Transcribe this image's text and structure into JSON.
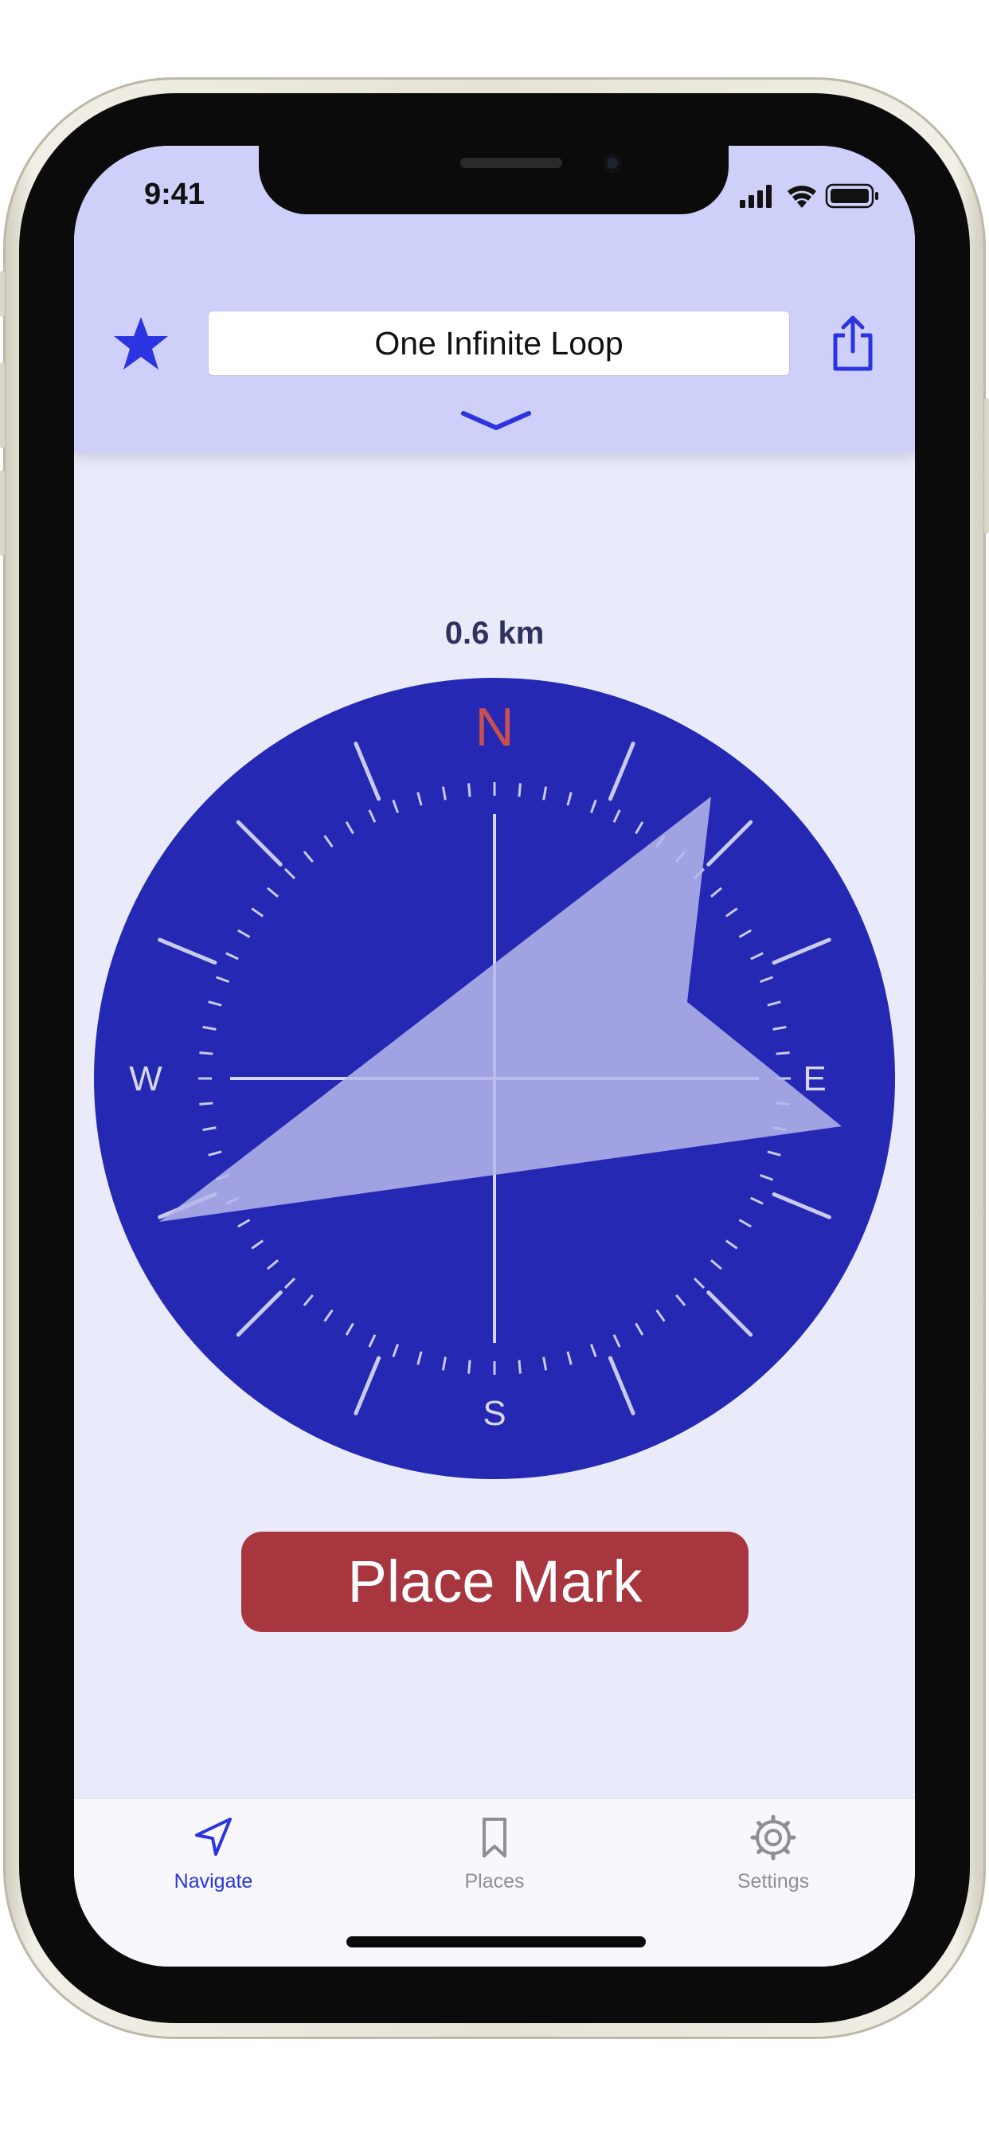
{
  "status_bar": {
    "time": "9:41"
  },
  "header": {
    "address": "One Infinite Loop"
  },
  "compass": {
    "distance": "0.6 km",
    "labels": {
      "north": "N",
      "east": "E",
      "south": "S",
      "west": "W"
    }
  },
  "actions": {
    "place_mark_label": "Place Mark"
  },
  "tabs": [
    {
      "label": "Navigate",
      "icon": "navigate-icon",
      "active": true
    },
    {
      "label": "Places",
      "icon": "bookmark-icon",
      "active": false
    },
    {
      "label": "Settings",
      "icon": "gear-icon",
      "active": false
    }
  ],
  "colors": {
    "accent": "#2b34e0",
    "header_bg": "#cfd0fa",
    "screen_bg": "#e9eafa",
    "compass_dial": "#2428b3",
    "north_label": "#c9504e",
    "button": "#a8363f",
    "inactive_tab": "#8e8e93"
  }
}
